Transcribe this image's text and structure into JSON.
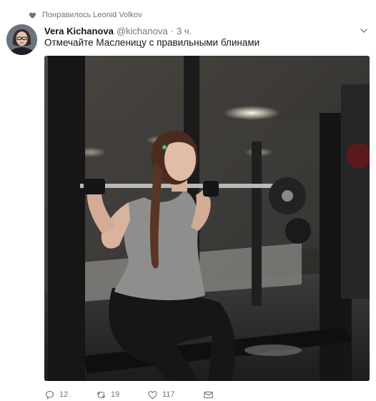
{
  "context": {
    "liked_by_text": "Понравилось Leonid Volkov",
    "icon": "heart-icon"
  },
  "tweet": {
    "author": {
      "display_name": "Vera Kichanova",
      "username": "@kichanova",
      "avatar_icon": "avatar"
    },
    "separator": "·",
    "timestamp": "3 ч.",
    "text": "Отмечайте Масленицу с правильными блинами",
    "menu_icon": "chevron-down-icon",
    "media": {
      "type": "photo",
      "alt_icon": "photo"
    },
    "actions": {
      "reply_count": "12",
      "retweet_count": "19",
      "like_count": "117",
      "icons": [
        "reply-icon",
        "retweet-icon",
        "heart-icon",
        "mail-icon"
      ]
    }
  },
  "colors": {
    "secondary_text": "#657786",
    "primary_text": "#14171a",
    "background": "#ffffff"
  }
}
